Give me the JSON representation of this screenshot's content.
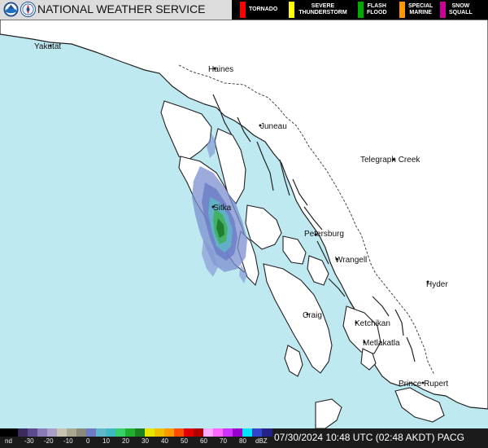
{
  "header": {
    "title": "NATIONAL WEATHER SERVICE",
    "legend": [
      {
        "label": "TORNADO",
        "color": "#ff0000"
      },
      {
        "label": "SEVERE THUNDERSTORM",
        "color": "#ffff00"
      },
      {
        "label": "FLASH FLOOD",
        "color": "#00aa00"
      },
      {
        "label": "SPECIAL MARINE",
        "color": "#ff9900"
      },
      {
        "label": "SNOW SQUALL",
        "color": "#cc0099"
      }
    ]
  },
  "map": {
    "cities": [
      "Yakutat",
      "Haines",
      "Juneau",
      "Telegraph Creek",
      "Sitka",
      "Petersburg",
      "Wrangell",
      "Hyder",
      "Craig",
      "Ketchikan",
      "Metlakatla",
      "Prince Rupert"
    ],
    "colors": {
      "ocean": "#bfe9f0",
      "land": "#ffffff",
      "border": "#333333"
    }
  },
  "footer": {
    "scale_labels": [
      "nd",
      "-30",
      "-20",
      "-10",
      "0",
      "10",
      "20",
      "30",
      "40",
      "50",
      "60",
      "70",
      "80",
      "dBZ"
    ],
    "timestamp": "07/30/2024 10:48 UTC (02:48 AKDT) PACG"
  }
}
